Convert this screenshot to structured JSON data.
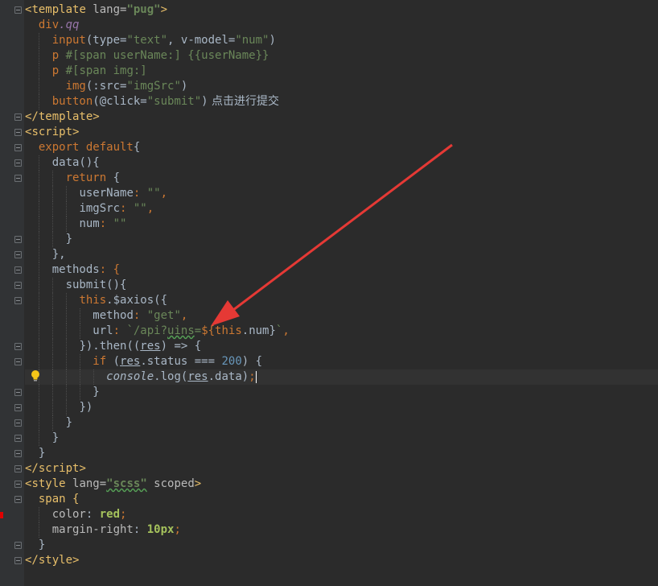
{
  "colors": {
    "background": "#2b2b2b",
    "gutter": "#313335",
    "annotation_arrow": "#e53935",
    "tag": "#e8bf6a",
    "string": "#6a8759",
    "keyword": "#cc7832",
    "number": "#6897bb"
  },
  "icons": {
    "bulb": "lightbulb-icon",
    "fold": "fold-marker-icon",
    "error": "error-marker-icon",
    "arrow": "annotation-arrow"
  },
  "code": {
    "l01": {
      "lt": "<",
      "tagname": "template",
      "attr": " lang=",
      "val": "\"pug\"",
      "gt": ">"
    },
    "l02": {
      "a": "div",
      "b": ".qq"
    },
    "l03": {
      "a": "input",
      "b": "(type=",
      "c": "\"text\"",
      "d": ", v-model=",
      "e": "\"num\"",
      "f": ")"
    },
    "l04": {
      "a": "p",
      "b": " #[span userName:] {{userName}}"
    },
    "l05": {
      "a": "p",
      "b": " #[span img:]"
    },
    "l06": {
      "a": "img",
      "b": "(:src=",
      "c": "\"imgSrc\"",
      "d": ")"
    },
    "l07": {
      "a": "button",
      "b": "(@click=",
      "c": "\"submit\"",
      "d": ")",
      "e": " 点击进行提交"
    },
    "l08": {
      "a": "</",
      "b": "template",
      "c": ">"
    },
    "l09": {
      "a": "<",
      "b": "script",
      "c": ">"
    },
    "l10": {
      "a": "export default",
      "b": "{"
    },
    "l11": {
      "a": "data(){"
    },
    "l12": {
      "a": "return",
      "b": " {"
    },
    "l13": {
      "a": "userName",
      "b": ": ",
      "c": "\"\"",
      "d": ","
    },
    "l14": {
      "a": "imgSrc",
      "b": ": ",
      "c": "\"\"",
      "d": ","
    },
    "l15": {
      "a": "num",
      "b": ": ",
      "c": "\"\""
    },
    "l16": {
      "a": "}"
    },
    "l17": {
      "a": "},"
    },
    "l18": {
      "a": "methods",
      "b": ": {"
    },
    "l19": {
      "a": "submit(){"
    },
    "l20": {
      "a": "this",
      "b": ".$axios({"
    },
    "l21": {
      "a": "method",
      "b": ": ",
      "c": "\"get\"",
      "d": ","
    },
    "l22": {
      "a": "url",
      "b": ": ",
      "c": "`/api?",
      "d": "uins",
      "e": "=",
      "f": "${",
      "g": "this",
      "h": ".num}",
      "i": "`",
      "j": ","
    },
    "l23": {
      "a": "}).then((",
      "b": "res",
      "c": ") => {"
    },
    "l24": {
      "a": "if",
      "b": " (",
      "c": "res",
      "d": ".status === ",
      "e": "200",
      "f": ") {"
    },
    "l25": {
      "a": "console",
      "b": ".log(",
      "c": "res",
      "d": ".data)",
      "e": ";"
    },
    "l26": {
      "a": "}"
    },
    "l27": {
      "a": "})"
    },
    "l28": {
      "a": "}"
    },
    "l29": {
      "a": "}"
    },
    "l30": {
      "a": "}"
    },
    "l31": {
      "a": "</",
      "b": "script",
      "c": ">"
    },
    "l32": {
      "a": "<",
      "b": "style",
      "c": " lang=",
      "d": "\"scss\"",
      "e": " scoped",
      "f": ">"
    },
    "l33": {
      "a": "span {"
    },
    "l34": {
      "a": "color",
      "b": ": ",
      "c": "red",
      "d": ";"
    },
    "l35": {
      "a": "margin-right",
      "b": ": ",
      "c": "10px",
      "d": ";"
    },
    "l36": {
      "a": "}"
    },
    "l37": {
      "a": "</",
      "b": "style",
      "c": ">"
    }
  }
}
